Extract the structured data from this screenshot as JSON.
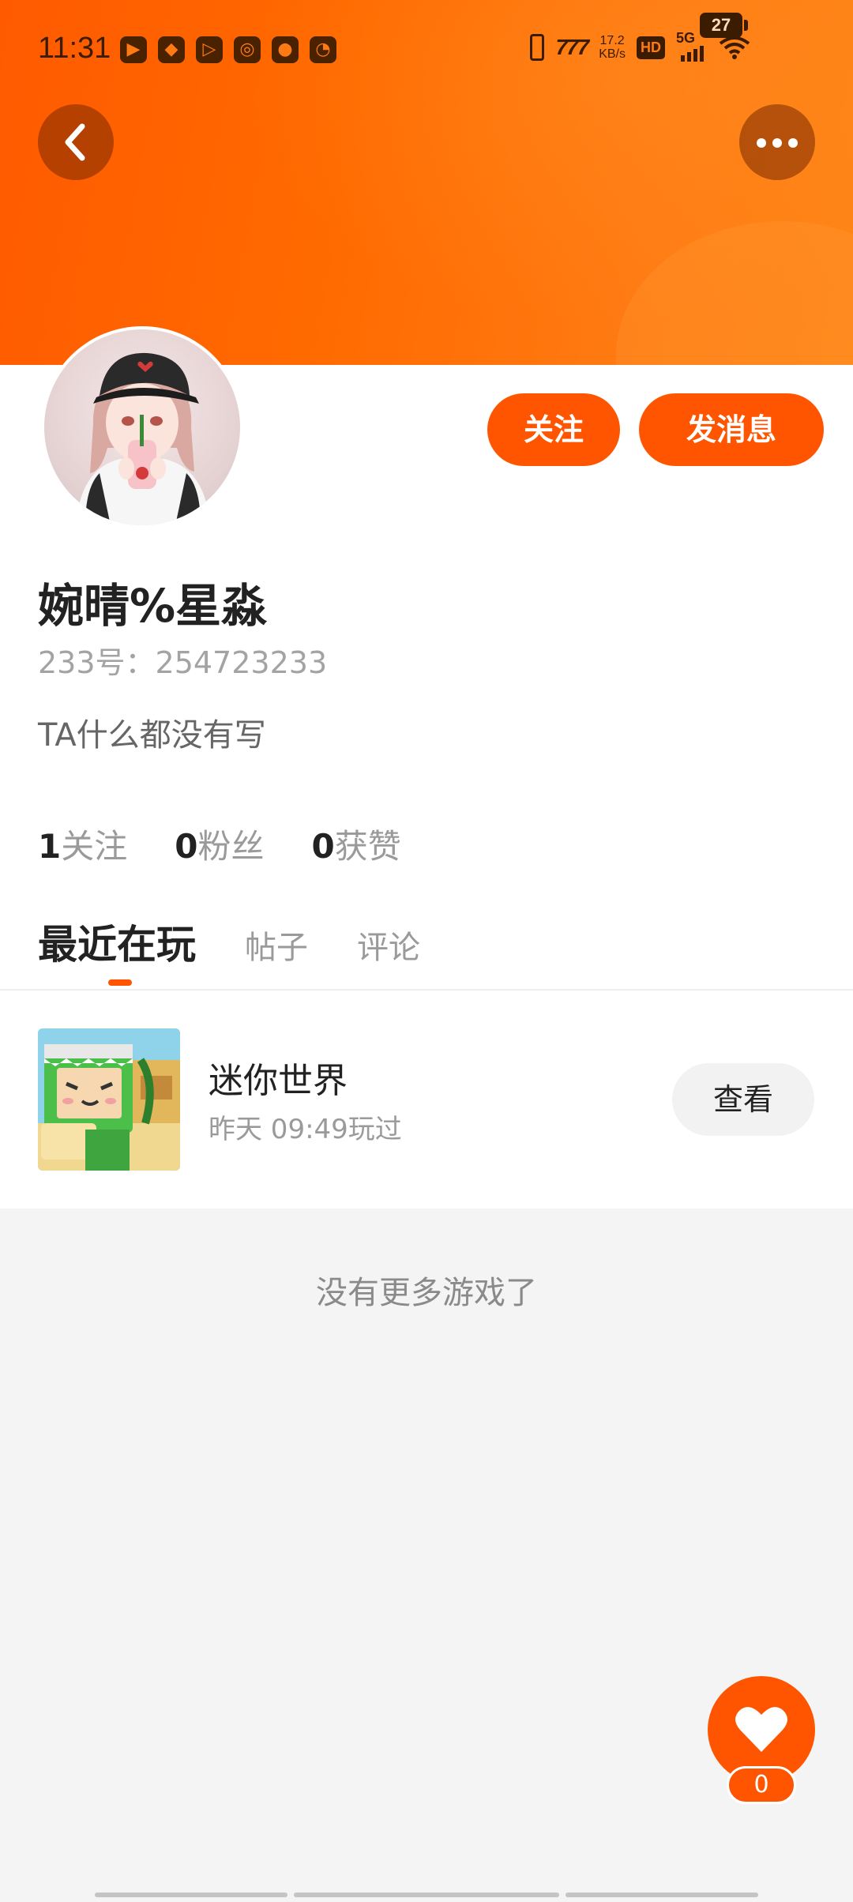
{
  "status_bar": {
    "time": "11:31",
    "net_speed_value": "17.2",
    "net_speed_unit": "KB/s",
    "hd_badge": "HD",
    "signal_label": "5G",
    "battery": "27"
  },
  "header": {
    "back_icon": "chevron-left-icon",
    "more_icon": "more-horizontal-icon"
  },
  "profile": {
    "name": "婉晴%星淼",
    "id_line": "233号：254723233",
    "bio": "TA什么都没有写",
    "follow_label": "关注",
    "message_label": "发消息"
  },
  "stats": [
    {
      "num": "1",
      "label": "关注"
    },
    {
      "num": "0",
      "label": "粉丝"
    },
    {
      "num": "0",
      "label": "获赞"
    }
  ],
  "tabs": [
    {
      "label": "最近在玩",
      "active": true
    },
    {
      "label": "帖子",
      "active": false
    },
    {
      "label": "评论",
      "active": false
    }
  ],
  "recent_games": [
    {
      "title": "迷你世界",
      "played": "昨天 09:49玩过",
      "action": "查看"
    }
  ],
  "empty_text": "没有更多游戏了",
  "like": {
    "icon": "heart-icon",
    "count": "0"
  },
  "colors": {
    "accent": "#ff5500",
    "header_gradient_start": "#ff5a00",
    "header_gradient_end": "#ff8416"
  }
}
